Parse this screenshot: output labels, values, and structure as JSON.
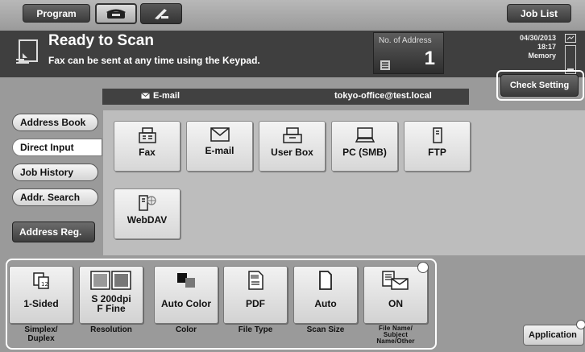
{
  "topbar": {
    "program_label": "Program",
    "joblist_label": "Job List",
    "mode_icons": [
      "phone-icon",
      "fax-line-icon"
    ]
  },
  "status": {
    "title": "Ready to Scan",
    "subtitle": "Fax can be sent at any time using the Keypad.",
    "address_count_label": "No. of Address",
    "address_count": "1",
    "date": "04/30/2013",
    "time": "18:17",
    "memory_label": "Memory"
  },
  "destination": {
    "type_label": "E-mail",
    "value": "tokyo-office@test.local"
  },
  "check_setting_label": "Check Setting",
  "nav": {
    "address_book": "Address Book",
    "direct_input": "Direct Input",
    "job_history": "Job History",
    "addr_search": "Addr. Search",
    "address_reg": "Address Reg."
  },
  "tiles": {
    "fax": "Fax",
    "email": "E-mail",
    "user_box": "User Box",
    "pc_smb": "PC (SMB)",
    "ftp": "FTP",
    "webdav": "WebDAV"
  },
  "settings": {
    "simplex": {
      "value": "1-Sided",
      "label_1": "Simplex/",
      "label_2": "Duplex"
    },
    "resolution": {
      "value_1": "S 200dpi",
      "value_2": "F Fine",
      "label": "Resolution"
    },
    "color": {
      "value": "Auto Color",
      "label": "Color"
    },
    "file_type": {
      "value": "PDF",
      "label": "File Type"
    },
    "scan_size": {
      "value": "Auto",
      "label": "Scan Size"
    },
    "file_name": {
      "value": "ON",
      "label_1": "File Name/",
      "label_2": "Subject",
      "label_3": "Name/Other"
    }
  },
  "application_label": "Application"
}
